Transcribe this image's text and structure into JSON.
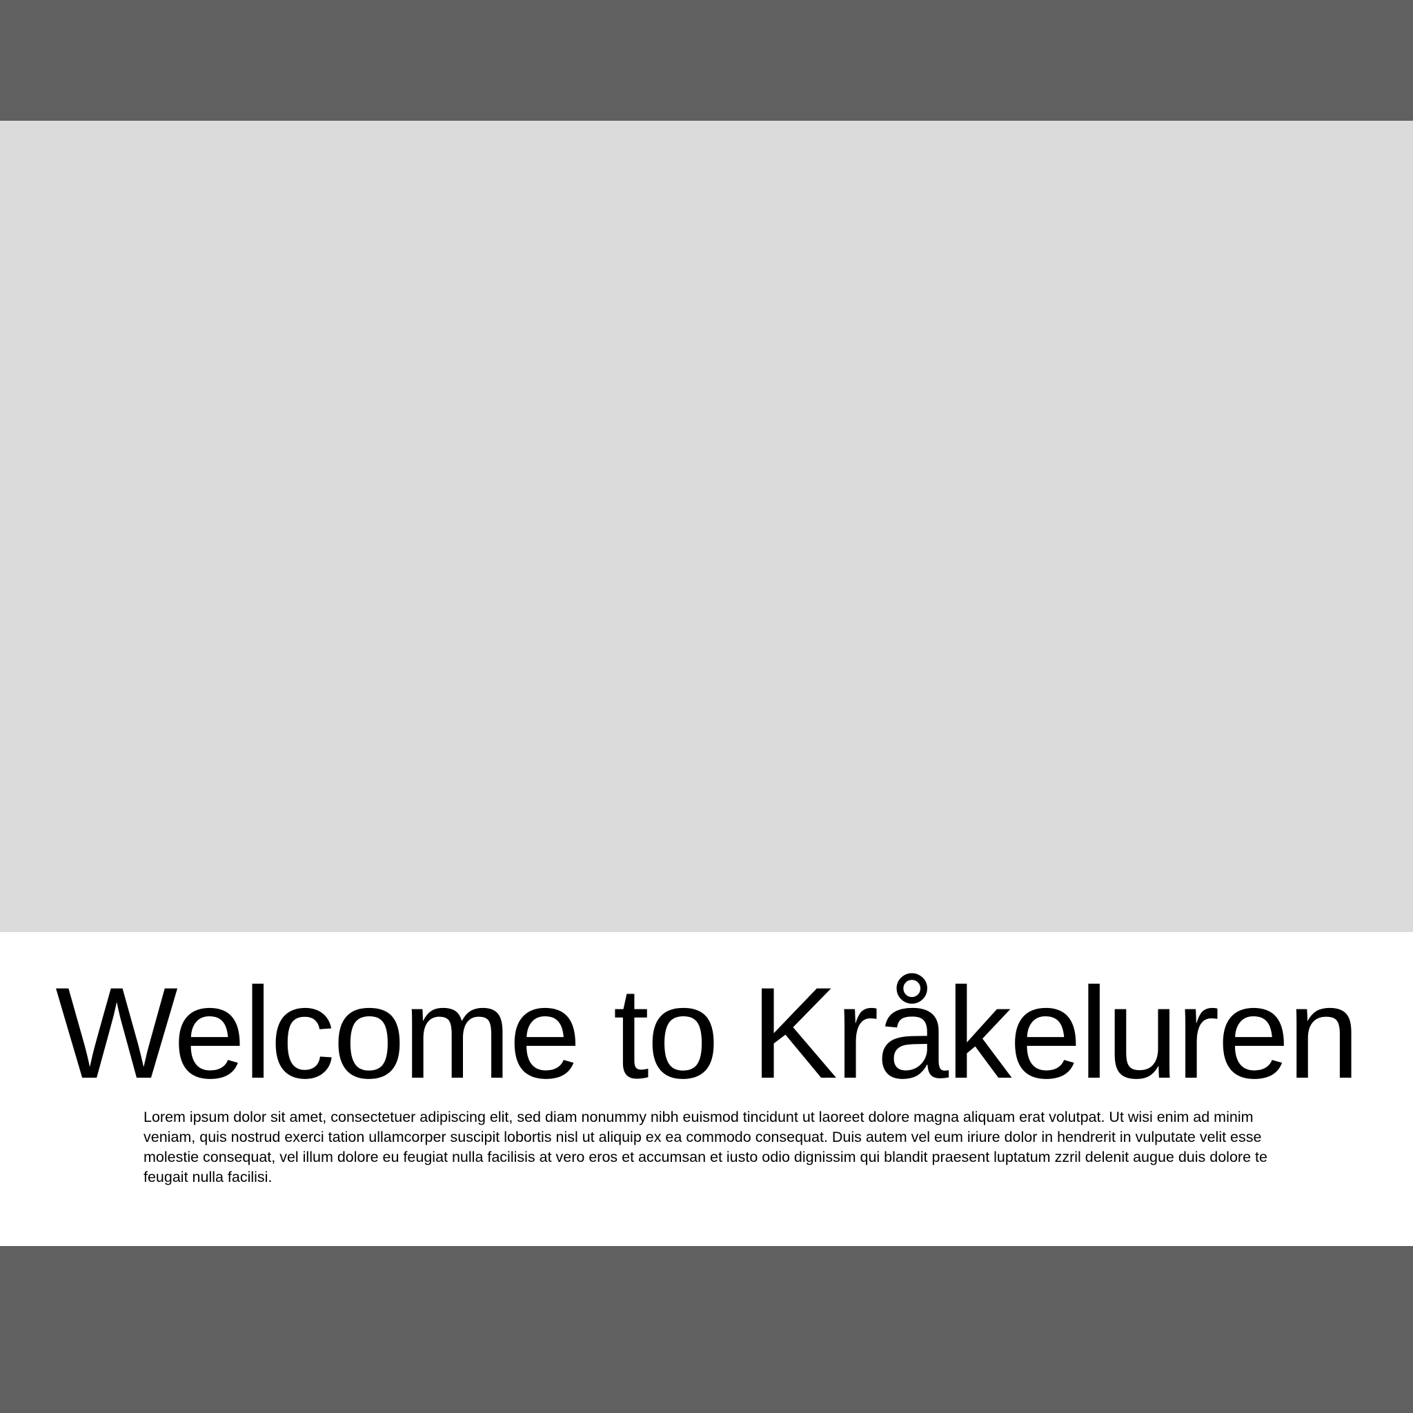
{
  "colors": {
    "header_bar": "#606060",
    "hero_placeholder": "#dbdbdb",
    "content_background": "#ffffff",
    "footer_bar": "#606060",
    "text": "#000000"
  },
  "main": {
    "headline": "Welcome to Kråkeluren",
    "body": "Lorem ipsum dolor sit amet, consectetuer adipiscing elit, sed diam nonummy nibh euismod tincidunt ut laoreet dolore magna aliquam erat volutpat. Ut wisi enim ad minim veniam, quis nostrud exerci tation ullamcorper suscipit lobortis nisl ut aliquip ex ea commodo consequat. Duis autem vel eum iriure dolor in hendrerit in vulputate velit esse molestie consequat, vel illum dolore eu feugiat nulla facilisis at vero eros et accumsan et iusto odio dignissim qui blandit praesent luptatum zzril delenit augue duis dolore te feugait nulla facilisi."
  }
}
